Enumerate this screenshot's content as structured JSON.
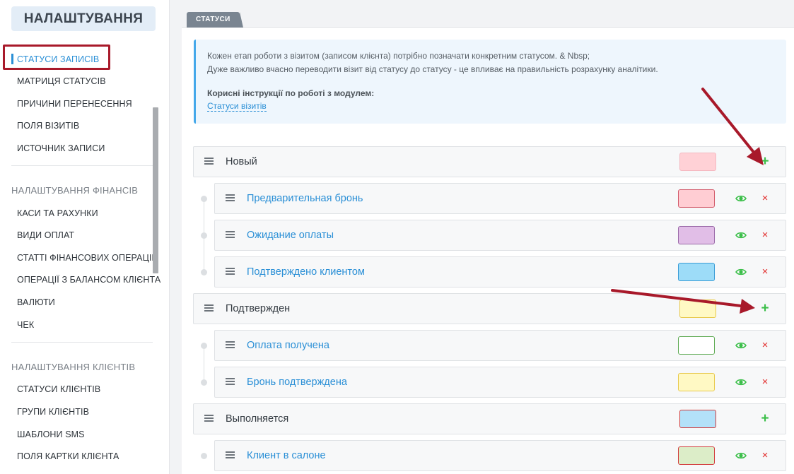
{
  "sidebar": {
    "title": "НАЛАШТУВАННЯ",
    "active_item": "СТАТУСИ ЗАПИСІВ",
    "group1": [
      "МАТРИЦЯ СТАТУСІВ",
      "ПРИЧИНИ ПЕРЕНЕСЕННЯ",
      "ПОЛЯ ВІЗИТІВ",
      "ИСТОЧНИК ЗАПИСИ"
    ],
    "section_finance": "НАЛАШТУВАННЯ ФІНАНСІВ",
    "group2": [
      "КАСИ ТА РАХУНКИ",
      "ВИДИ ОПЛАТ",
      "СТАТТІ ФІНАНСОВИХ ОПЕРАЦІЙ",
      "ОПЕРАЦІЇ З БАЛАНСОМ КЛІЄНТА",
      "ВАЛЮТИ",
      "ЧЕК"
    ],
    "section_clients": "НАЛАШТУВАННЯ КЛІЄНТІВ",
    "group3": [
      "СТАТУСИ КЛІЄНТІВ",
      "ГРУПИ КЛІЄНТІВ",
      "ШАБЛОНИ SMS",
      "ПОЛЯ КАРТКИ КЛІЄНТА"
    ]
  },
  "tab": {
    "label": "СТАТУСИ"
  },
  "info": {
    "line1": "Кожен етап роботи з візитом (записом клієнта) потрібно позначати конкретним статусом. & Nbsp;",
    "line2": "Дуже важливо вчасно переводити візит від статусу до статусу - це впливає на правильність розрахунку аналітики.",
    "instructions_label": "Корисні інструкції по роботі з модулем:",
    "link": "Статуси візитів"
  },
  "statuses": [
    {
      "name": "Новый",
      "color": "#ffd1d6",
      "border": "#f4b8c0",
      "children": [
        {
          "name": "Предварительная бронь",
          "color": "#ffcdd3",
          "border": "#d25a6a"
        },
        {
          "name": "Ожидание оплаты",
          "color": "#e1bee7",
          "border": "#9a6aa8"
        },
        {
          "name": "Подтверждено клиентом",
          "color": "#9ddcf8",
          "border": "#3a9cd6"
        }
      ]
    },
    {
      "name": "Подтвержден",
      "color": "#fff9c4",
      "border": "#e8c94c",
      "children": [
        {
          "name": "Оплата получена",
          "color": "#ffffff",
          "border": "#5daa52"
        },
        {
          "name": "Бронь подтверждена",
          "color": "#fff9c4",
          "border": "#e8c94c"
        }
      ]
    },
    {
      "name": "Выполняется",
      "color": "#b3e1f9",
      "border": "#d23b3b",
      "children": [
        {
          "name": "Клиент в салоне",
          "color": "#dcedc8",
          "border": "#d23b3b"
        }
      ]
    }
  ],
  "colors": {
    "accent": "#2a8fd6",
    "add": "#3cbf4a",
    "delete": "#e2302f",
    "eye": "#3cbf4a",
    "annotation": "#a8192a"
  },
  "icons": {
    "add": "+",
    "delete": "×",
    "eye": "eye-icon",
    "drag": "drag-handle-icon"
  }
}
